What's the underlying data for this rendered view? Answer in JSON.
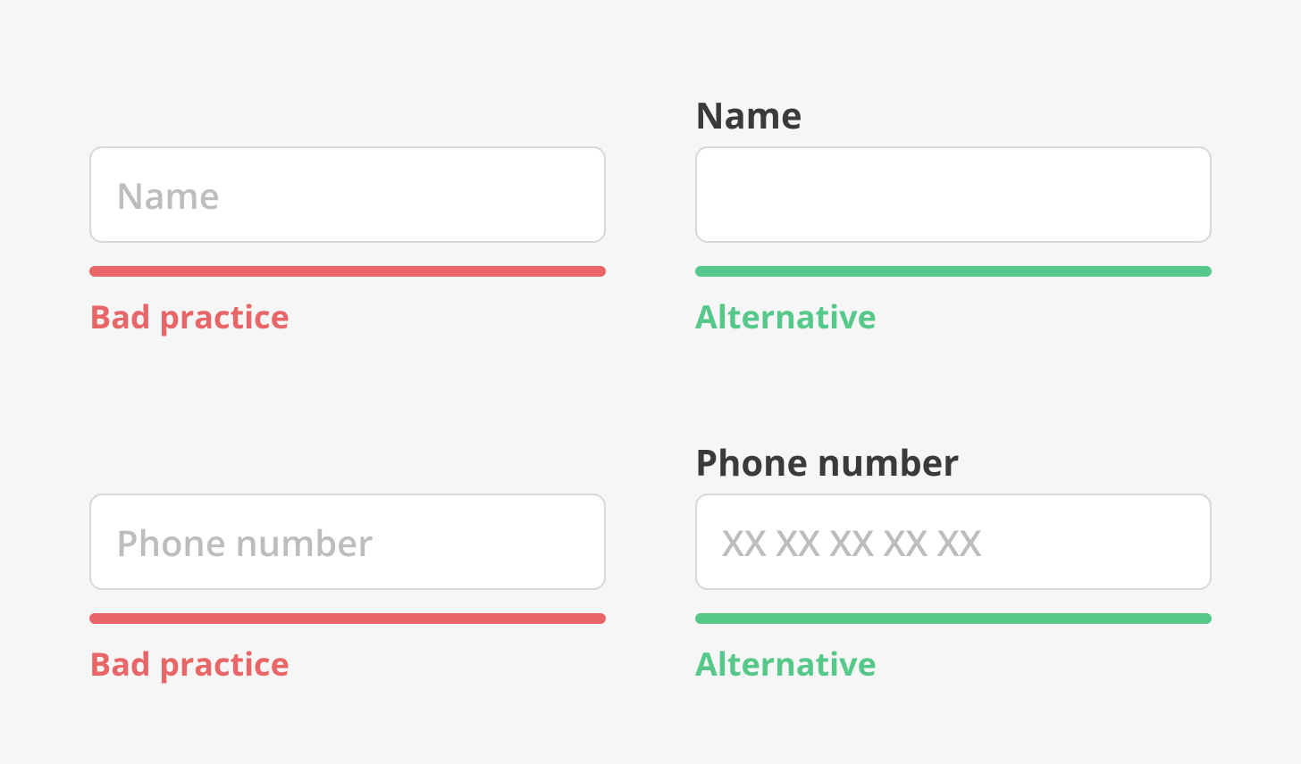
{
  "examples": [
    {
      "bad": {
        "placeholder": "Name",
        "verdict": "Bad practice"
      },
      "good": {
        "label": "Name",
        "placeholder": "",
        "verdict": "Alternative"
      }
    },
    {
      "bad": {
        "placeholder": "Phone number",
        "verdict": "Bad practice"
      },
      "good": {
        "label": "Phone number",
        "placeholder": "XX XX XX XX XX",
        "verdict": "Alternative"
      }
    }
  ],
  "colors": {
    "bad": "#e86667",
    "good": "#56c98a",
    "border": "#d7d7dd",
    "placeholder": "#bdbdbd",
    "text": "#3a3a3a",
    "bg": "#f6f6f6"
  }
}
